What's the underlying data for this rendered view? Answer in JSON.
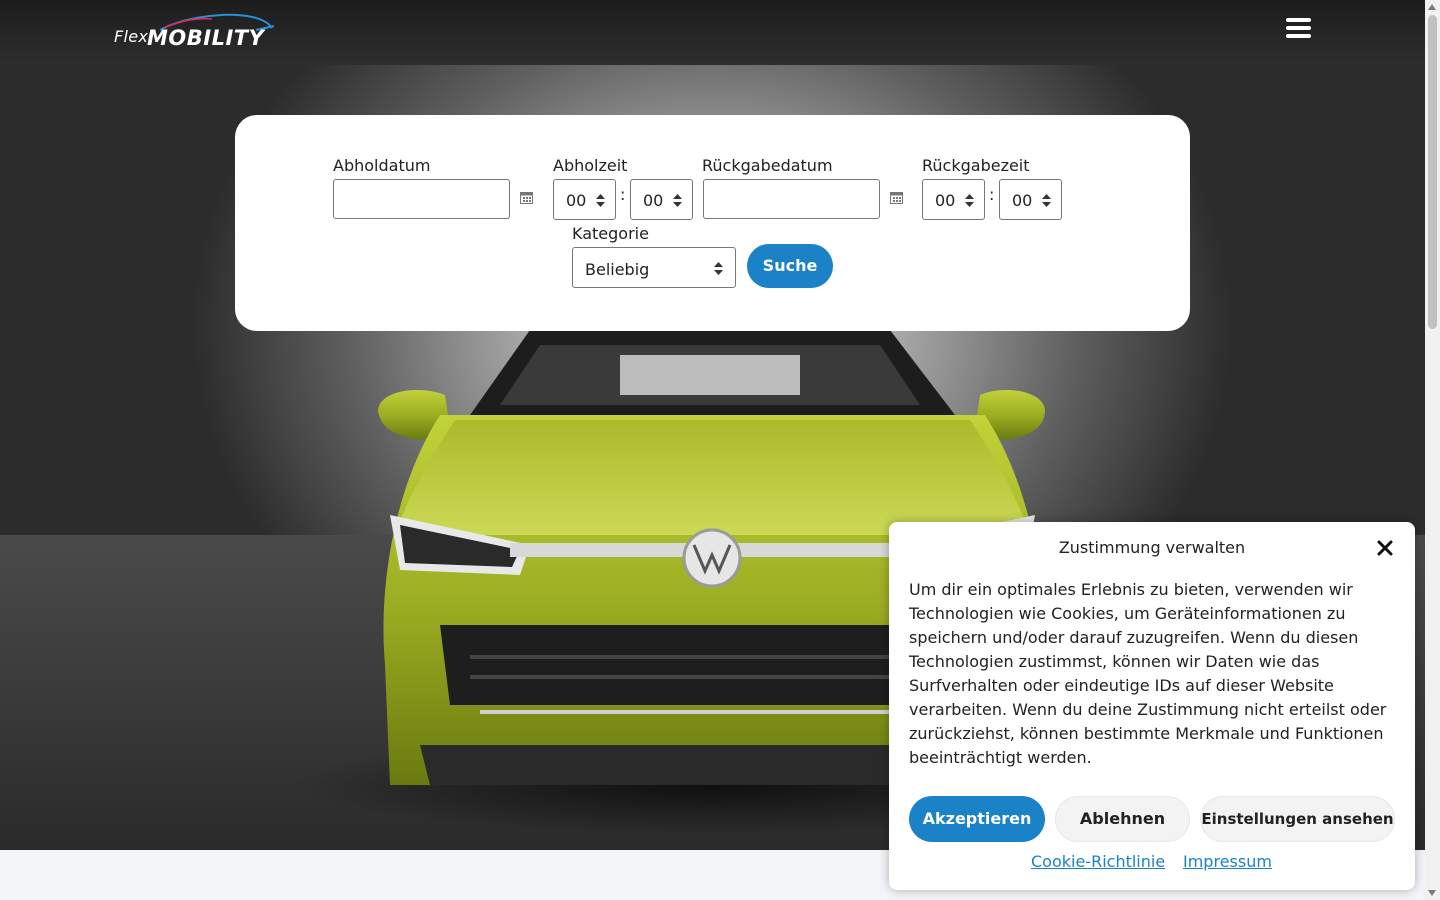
{
  "header": {
    "logo_flex": "Flex",
    "logo_mobility": "MOBILITY",
    "menu_icon": "hamburger-menu-icon"
  },
  "booking": {
    "pickup_date_label": "Abholdatum",
    "pickup_date_value": "",
    "pickup_time_label": "Abholzeit",
    "pickup_hour": "00",
    "pickup_minute": "00",
    "return_date_label": "Rückgabedatum",
    "return_date_value": "",
    "return_time_label": "Rückgabezeit",
    "return_hour": "00",
    "return_minute": "00",
    "time_separator": ":",
    "category_label": "Kategorie",
    "category_value": "Beliebig",
    "search_label": "Suche",
    "calendar_icon": "calendar-icon"
  },
  "consent": {
    "title": "Zustimmung verwalten",
    "body": "Um dir ein optimales Erlebnis zu bieten, verwenden wir Technologien wie Cookies, um Geräteinformationen zu speichern und/oder darauf zuzugreifen. Wenn du diesen Technologien zustimmst, können wir Daten wie das Surfverhalten oder eindeutige IDs auf dieser Website verarbeiten. Wenn du deine Zustimmung nicht erteilst oder zurückziehst, können bestimmte Merkmale und Funktionen beeinträchtigt werden.",
    "accept_label": "Akzeptieren",
    "deny_label": "Ablehnen",
    "settings_label": "Einstellungen ansehen",
    "cookie_policy_link": "Cookie-Richtlinie",
    "imprint_link": "Impressum",
    "close_icon": "close-icon"
  },
  "colors": {
    "accent": "#1b82c8",
    "header_bg": "#262626",
    "car_color": "#9cae22"
  }
}
